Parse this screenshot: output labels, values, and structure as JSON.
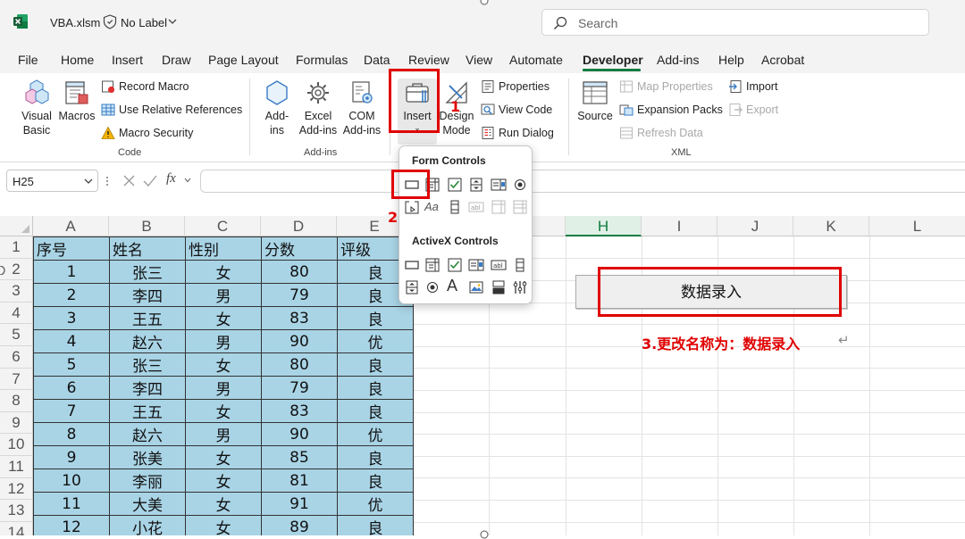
{
  "titlebar": {
    "file_name": "VBA.xlsm",
    "sensitivity": "No Label",
    "search_placeholder": "Search"
  },
  "tabs": [
    "File",
    "Home",
    "Insert",
    "Draw",
    "Page Layout",
    "Formulas",
    "Data",
    "Review",
    "View",
    "Automate",
    "Developer",
    "Add-ins",
    "Help",
    "Acrobat"
  ],
  "active_tab": "Developer",
  "ribbon": {
    "code": {
      "visual_basic": [
        "Visual",
        "Basic"
      ],
      "macros": "Macros",
      "record_macro": "Record Macro",
      "relative_refs": "Use Relative References",
      "macro_security": "Macro Security",
      "group_label": "Code"
    },
    "addins": {
      "addins": [
        "Add-",
        "ins"
      ],
      "excel_addins": [
        "Excel",
        "Add-ins"
      ],
      "com_addins": [
        "COM",
        "Add-ins"
      ],
      "group_label": "Add-ins"
    },
    "controls": {
      "insert": "Insert",
      "design_mode": [
        "Design",
        "Mode"
      ],
      "properties": "Properties",
      "view_code": "View Code",
      "run_dialog": "Run Dialog"
    },
    "xml": {
      "source": "Source",
      "map_properties": "Map Properties",
      "expansion_packs": "Expansion Packs",
      "refresh_data": "Refresh Data",
      "import": "Import",
      "export": "Export",
      "group_label": "XML"
    }
  },
  "formula_bar": {
    "name_box": "H25",
    "fx": "fx",
    "formula": ""
  },
  "insert_dropdown": {
    "form_controls_title": "Form Controls",
    "activex_controls_title": "ActiveX Controls"
  },
  "sheet": {
    "columns": [
      "A",
      "B",
      "C",
      "D",
      "E",
      "",
      "",
      "H",
      "I",
      "J",
      "K",
      "L"
    ],
    "rows": [
      "1",
      "2",
      "3",
      "4",
      "5",
      "6",
      "7",
      "8",
      "9",
      "10",
      "11",
      "12",
      "13",
      "14"
    ],
    "table_headers": [
      "序号",
      "姓名",
      "性别",
      "分数",
      "评级"
    ],
    "table_rows": [
      [
        "1",
        "张三",
        "女",
        "80",
        "良"
      ],
      [
        "2",
        "李四",
        "男",
        "79",
        "良"
      ],
      [
        "3",
        "王五",
        "女",
        "83",
        "良"
      ],
      [
        "4",
        "赵六",
        "男",
        "90",
        "优"
      ],
      [
        "5",
        "张三",
        "女",
        "80",
        "良"
      ],
      [
        "6",
        "李四",
        "男",
        "79",
        "良"
      ],
      [
        "7",
        "王五",
        "女",
        "83",
        "良"
      ],
      [
        "8",
        "赵六",
        "男",
        "90",
        "优"
      ],
      [
        "9",
        "张美",
        "女",
        "85",
        "良"
      ],
      [
        "10",
        "李丽",
        "女",
        "81",
        "良"
      ],
      [
        "11",
        "大美",
        "女",
        "91",
        "优"
      ],
      [
        "12",
        "小花",
        "女",
        "89",
        "良"
      ]
    ],
    "button_label": "数据录入"
  },
  "annotations": {
    "step1": "1",
    "step2": "2",
    "step3": "3.更改名称为：数据录入",
    "return_mark": "↵"
  },
  "colors": {
    "accent": "#107c41",
    "table_fill": "#a9d4e6",
    "annotation_red": "#e00000"
  }
}
